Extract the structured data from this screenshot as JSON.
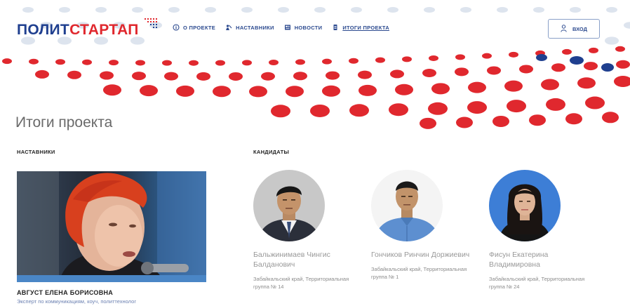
{
  "header": {
    "logo_part1": "ПОЛИТ",
    "logo_part2": "СТАРТАП",
    "nav": [
      {
        "label": "О ПРОЕКТЕ",
        "icon": "info-icon"
      },
      {
        "label": "НАСТАВНИКИ",
        "icon": "mentors-icon"
      },
      {
        "label": "НОВОСТИ",
        "icon": "news-icon"
      },
      {
        "label": "ИТОГИ ПРОЕКТА",
        "icon": "results-icon"
      }
    ],
    "login_label": "ВХОД"
  },
  "page": {
    "title": "Итоги проекта"
  },
  "mentors": {
    "section_label": "НАСТАВНИКИ",
    "items": [
      {
        "name": "АВГУСТ ЕЛЕНА БОРИСОВНА",
        "description": "Эксперт по коммуникациям, коуч, политтехнолог"
      }
    ]
  },
  "candidates": {
    "section_label": "КАНДИДАТЫ",
    "items": [
      {
        "name": "Бальжинимаев Чингис Балданович",
        "region": "Забайкальский край, Территориальная группа № 14"
      },
      {
        "name": "Гончиков Ринчин Доржиевич",
        "region": "Забайкальский край, Территориальная группа № 1"
      },
      {
        "name": "Фисун Екатерина Владимировна",
        "region": "Забайкальский край, Территориальная группа № 24"
      }
    ]
  },
  "colors": {
    "brand_blue": "#1f3f8f",
    "brand_red": "#e0282e",
    "nav_blue": "#2c4a8f",
    "light_dot": "#dde4ee"
  }
}
